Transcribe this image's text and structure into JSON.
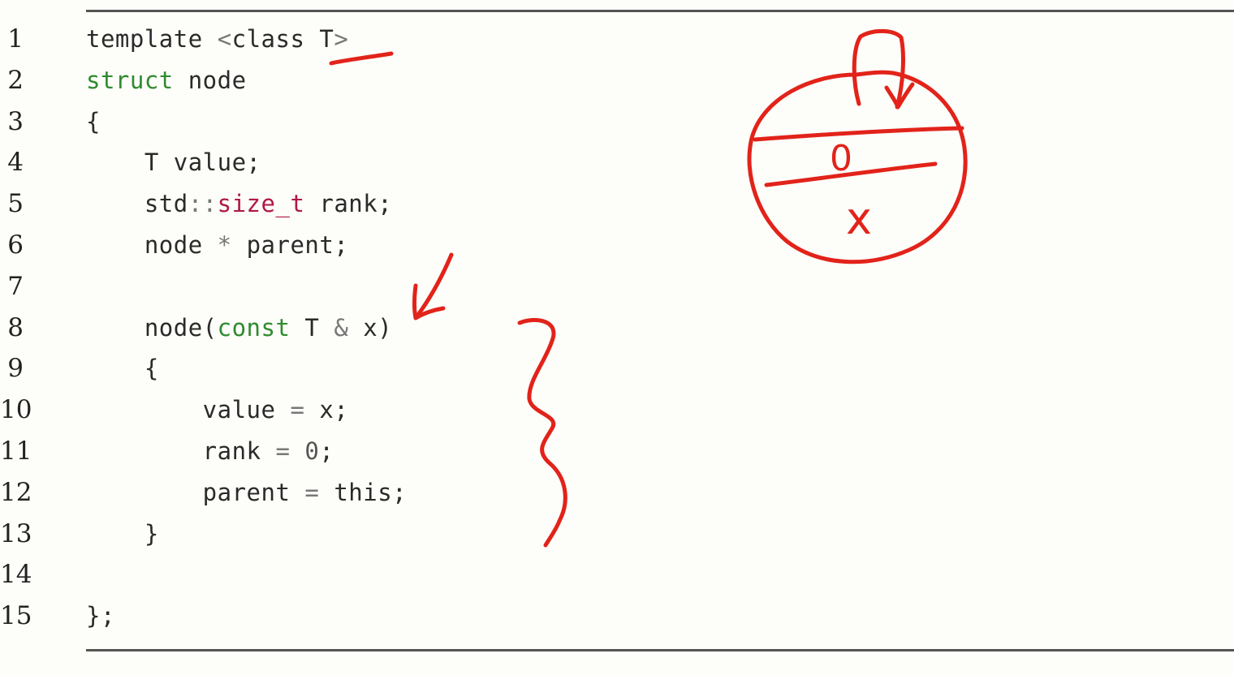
{
  "lines": [
    {
      "n": "1",
      "parts": [
        {
          "t": "template ",
          "c": ""
        },
        {
          "t": "<",
          "c": "op"
        },
        {
          "t": "class T",
          "c": ""
        },
        {
          "t": ">",
          "c": "op"
        }
      ]
    },
    {
      "n": "2",
      "parts": [
        {
          "t": "struct",
          "c": "kw"
        },
        {
          "t": " node",
          "c": ""
        }
      ]
    },
    {
      "n": "3",
      "parts": [
        {
          "t": "{",
          "c": ""
        }
      ]
    },
    {
      "n": "4",
      "parts": [
        {
          "t": "    T value;",
          "c": ""
        }
      ]
    },
    {
      "n": "5",
      "parts": [
        {
          "t": "    std",
          "c": ""
        },
        {
          "t": "::",
          "c": "op"
        },
        {
          "t": "size_t",
          "c": "ty"
        },
        {
          "t": " rank;",
          "c": ""
        }
      ]
    },
    {
      "n": "6",
      "parts": [
        {
          "t": "    node ",
          "c": ""
        },
        {
          "t": "*",
          "c": "op"
        },
        {
          "t": " parent;",
          "c": ""
        }
      ]
    },
    {
      "n": "7",
      "parts": []
    },
    {
      "n": "8",
      "parts": [
        {
          "t": "    node(",
          "c": ""
        },
        {
          "t": "const",
          "c": "kw"
        },
        {
          "t": " T ",
          "c": ""
        },
        {
          "t": "&",
          "c": "op"
        },
        {
          "t": " x)",
          "c": ""
        }
      ]
    },
    {
      "n": "9",
      "parts": [
        {
          "t": "    {",
          "c": ""
        }
      ]
    },
    {
      "n": "10",
      "parts": [
        {
          "t": "        value ",
          "c": ""
        },
        {
          "t": "=",
          "c": "op"
        },
        {
          "t": " x;",
          "c": ""
        }
      ]
    },
    {
      "n": "11",
      "parts": [
        {
          "t": "        rank ",
          "c": ""
        },
        {
          "t": "=",
          "c": "op"
        },
        {
          "t": " ",
          "c": ""
        },
        {
          "t": "0",
          "c": "num"
        },
        {
          "t": ";",
          "c": ""
        }
      ]
    },
    {
      "n": "12",
      "parts": [
        {
          "t": "        parent ",
          "c": ""
        },
        {
          "t": "=",
          "c": "op"
        },
        {
          "t": " this;",
          "c": ""
        }
      ]
    },
    {
      "n": "13",
      "parts": [
        {
          "t": "    }",
          "c": ""
        }
      ]
    },
    {
      "n": "14",
      "parts": []
    },
    {
      "n": "15",
      "parts": [
        {
          "t": "};",
          "c": ""
        }
      ]
    }
  ],
  "annotations": {
    "ink_color": "#e2231a",
    "node_diagram_middle": "0",
    "node_diagram_bottom": "x"
  }
}
